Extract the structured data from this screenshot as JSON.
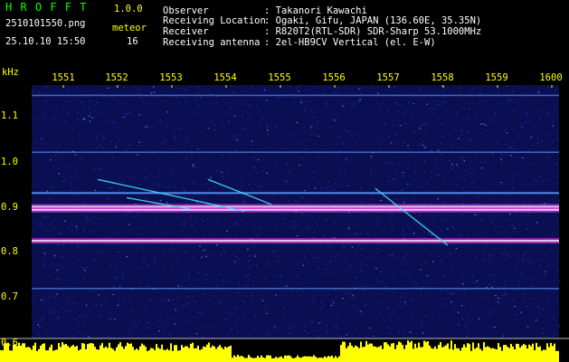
{
  "header": {
    "app_name": "H R O F F T",
    "version": "1.0.0",
    "filename": "2510101550.png",
    "event_label": "meteor",
    "datetime": "25.10.10 15:50",
    "event_count": "16"
  },
  "station": {
    "rows": [
      {
        "label": "Observer",
        "value": ": Takanori Kawachi"
      },
      {
        "label": "Receiving Location",
        "value": ": Ogaki, Gifu, JAPAN (136.60E, 35.35N)"
      },
      {
        "label": "Receiver",
        "value": ": R820T2(RTL-SDR) SDR-Sharp 53.1000MHz"
      },
      {
        "label": "Receiving antenna",
        "value": ": 2el-HB9CV Vertical (el. E-W)"
      }
    ]
  },
  "chart_data": {
    "type": "heatmap",
    "title": "",
    "xlabel": "",
    "ylabel": "kHz",
    "x_ticks": [
      "1551",
      "1552",
      "1553",
      "1554",
      "1555",
      "1556",
      "1557",
      "1558",
      "1559",
      "1600"
    ],
    "y_ticks": [
      "1.1",
      "1.0",
      "0.9",
      "0.8",
      "0.7",
      "0.6"
    ],
    "y_range_khz": [
      0.6,
      1.15
    ],
    "grid": false,
    "carriers_khz": [
      {
        "freq": 1.145,
        "strength": "weak"
      },
      {
        "freq": 1.02,
        "strength": "weak"
      },
      {
        "freq": 0.93,
        "strength": "medium"
      },
      {
        "freq": 0.9,
        "strength": "strong"
      },
      {
        "freq": 0.893,
        "strength": "strong"
      },
      {
        "freq": 0.825,
        "strength": "strong"
      },
      {
        "freq": 0.72,
        "strength": "weak"
      }
    ],
    "colors": {
      "background": "#000000",
      "noise": "#1e2ea8",
      "carrier_weak": "#5fa0ff",
      "carrier_strong": "#ff40ff",
      "carrier_core": "#ffffff",
      "meteor": "#40e0ff",
      "level_bar": "#ffff00",
      "tick": "#ffff00",
      "text": "#ffffff"
    }
  }
}
